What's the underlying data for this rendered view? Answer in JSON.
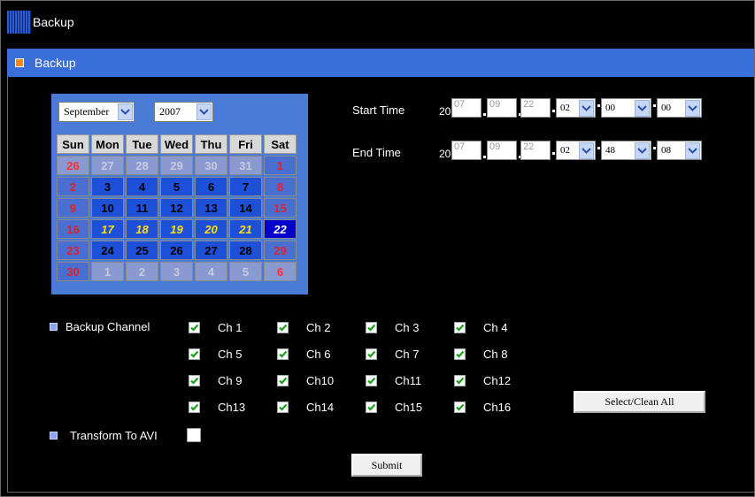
{
  "window": {
    "title": "Backup"
  },
  "section": {
    "title": "Backup"
  },
  "calendar": {
    "month": "September",
    "year": "2007",
    "weekdays": [
      "Sun",
      "Mon",
      "Tue",
      "Wed",
      "Thu",
      "Fri",
      "Sat"
    ],
    "weeks": [
      [
        "26",
        "27",
        "28",
        "29",
        "30",
        "31",
        "1"
      ],
      [
        "2",
        "3",
        "4",
        "5",
        "6",
        "7",
        "8"
      ],
      [
        "9",
        "10",
        "11",
        "12",
        "13",
        "14",
        "15"
      ],
      [
        "16",
        "17",
        "18",
        "19",
        "20",
        "21",
        "22"
      ],
      [
        "23",
        "24",
        "25",
        "26",
        "27",
        "28",
        "29"
      ],
      [
        "30",
        "1",
        "2",
        "3",
        "4",
        "5",
        "6"
      ]
    ],
    "selected_day": "22",
    "highlighted_days": [
      "17",
      "18",
      "19",
      "20",
      "21"
    ]
  },
  "start_time": {
    "label": "Start Time",
    "century": "20",
    "year": "07",
    "month": "09",
    "day": "22",
    "hour": "02",
    "minute": "00",
    "second": "00"
  },
  "end_time": {
    "label": "End Time",
    "century": "20",
    "year": "07",
    "month": "09",
    "day": "22",
    "hour": "02",
    "minute": "48",
    "second": "08"
  },
  "backup_channel": {
    "label": "Backup Channel",
    "channels": [
      {
        "label": "Ch 1",
        "checked": true
      },
      {
        "label": "Ch 2",
        "checked": true
      },
      {
        "label": "Ch 3",
        "checked": true
      },
      {
        "label": "Ch 4",
        "checked": true
      },
      {
        "label": "Ch 5",
        "checked": true
      },
      {
        "label": "Ch 6",
        "checked": true
      },
      {
        "label": "Ch 7",
        "checked": true
      },
      {
        "label": "Ch 8",
        "checked": true
      },
      {
        "label": "Ch 9",
        "checked": true
      },
      {
        "label": "Ch10",
        "checked": true
      },
      {
        "label": "Ch11",
        "checked": true
      },
      {
        "label": "Ch12",
        "checked": true
      },
      {
        "label": "Ch13",
        "checked": true
      },
      {
        "label": "Ch14",
        "checked": true
      },
      {
        "label": "Ch15",
        "checked": true
      },
      {
        "label": "Ch16",
        "checked": true
      }
    ],
    "select_all_label": "Select/Clean All"
  },
  "transform_avi": {
    "label": "Transform To AVI",
    "checked": false
  },
  "submit_label": "Submit",
  "colors": {
    "accent_bar": "#3a6ed8",
    "calendar_bg": "#4a7bd6",
    "background": "#000000",
    "section_dot": "#f08c1a"
  }
}
